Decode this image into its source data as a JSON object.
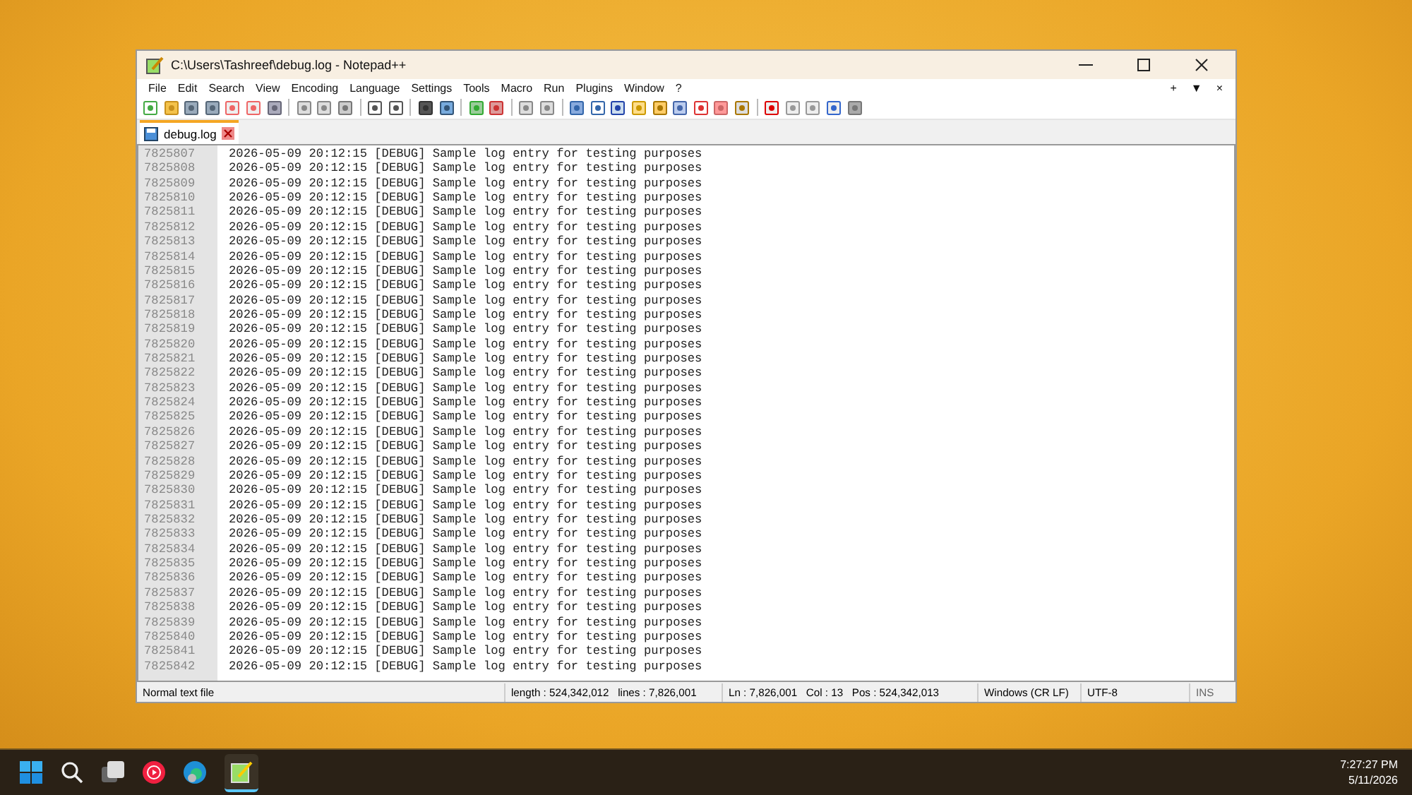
{
  "window": {
    "title": "C:\\Users\\Tashreef\\debug.log - Notepad++"
  },
  "menu": [
    "File",
    "Edit",
    "Search",
    "View",
    "Encoding",
    "Language",
    "Settings",
    "Tools",
    "Macro",
    "Run",
    "Plugins",
    "Window",
    "?"
  ],
  "menu_right": [
    "+",
    "▼",
    "×"
  ],
  "tabs": [
    {
      "label": "debug.log",
      "selected": true
    }
  ],
  "lines": [
    {
      "num": "7825807",
      "text": "2026-05-09 20:12:15 [DEBUG] Sample log entry for testing purposes"
    },
    {
      "num": "7825808",
      "text": "2026-05-09 20:12:15 [DEBUG] Sample log entry for testing purposes"
    },
    {
      "num": "7825809",
      "text": "2026-05-09 20:12:15 [DEBUG] Sample log entry for testing purposes"
    },
    {
      "num": "7825810",
      "text": "2026-05-09 20:12:15 [DEBUG] Sample log entry for testing purposes"
    },
    {
      "num": "7825811",
      "text": "2026-05-09 20:12:15 [DEBUG] Sample log entry for testing purposes"
    },
    {
      "num": "7825812",
      "text": "2026-05-09 20:12:15 [DEBUG] Sample log entry for testing purposes"
    },
    {
      "num": "7825813",
      "text": "2026-05-09 20:12:15 [DEBUG] Sample log entry for testing purposes"
    },
    {
      "num": "7825814",
      "text": "2026-05-09 20:12:15 [DEBUG] Sample log entry for testing purposes"
    },
    {
      "num": "7825815",
      "text": "2026-05-09 20:12:15 [DEBUG] Sample log entry for testing purposes"
    },
    {
      "num": "7825816",
      "text": "2026-05-09 20:12:15 [DEBUG] Sample log entry for testing purposes"
    },
    {
      "num": "7825817",
      "text": "2026-05-09 20:12:15 [DEBUG] Sample log entry for testing purposes"
    },
    {
      "num": "7825818",
      "text": "2026-05-09 20:12:15 [DEBUG] Sample log entry for testing purposes"
    },
    {
      "num": "7825819",
      "text": "2026-05-09 20:12:15 [DEBUG] Sample log entry for testing purposes"
    },
    {
      "num": "7825820",
      "text": "2026-05-09 20:12:15 [DEBUG] Sample log entry for testing purposes"
    },
    {
      "num": "7825821",
      "text": "2026-05-09 20:12:15 [DEBUG] Sample log entry for testing purposes"
    },
    {
      "num": "7825822",
      "text": "2026-05-09 20:12:15 [DEBUG] Sample log entry for testing purposes"
    },
    {
      "num": "7825823",
      "text": "2026-05-09 20:12:15 [DEBUG] Sample log entry for testing purposes"
    },
    {
      "num": "7825824",
      "text": "2026-05-09 20:12:15 [DEBUG] Sample log entry for testing purposes"
    },
    {
      "num": "7825825",
      "text": "2026-05-09 20:12:15 [DEBUG] Sample log entry for testing purposes"
    },
    {
      "num": "7825826",
      "text": "2026-05-09 20:12:15 [DEBUG] Sample log entry for testing purposes"
    },
    {
      "num": "7825827",
      "text": "2026-05-09 20:12:15 [DEBUG] Sample log entry for testing purposes"
    },
    {
      "num": "7825828",
      "text": "2026-05-09 20:12:15 [DEBUG] Sample log entry for testing purposes"
    },
    {
      "num": "7825829",
      "text": "2026-05-09 20:12:15 [DEBUG] Sample log entry for testing purposes"
    },
    {
      "num": "7825830",
      "text": "2026-05-09 20:12:15 [DEBUG] Sample log entry for testing purposes"
    },
    {
      "num": "7825831",
      "text": "2026-05-09 20:12:15 [DEBUG] Sample log entry for testing purposes"
    },
    {
      "num": "7825832",
      "text": "2026-05-09 20:12:15 [DEBUG] Sample log entry for testing purposes"
    },
    {
      "num": "7825833",
      "text": "2026-05-09 20:12:15 [DEBUG] Sample log entry for testing purposes"
    },
    {
      "num": "7825834",
      "text": "2026-05-09 20:12:15 [DEBUG] Sample log entry for testing purposes"
    },
    {
      "num": "7825835",
      "text": "2026-05-09 20:12:15 [DEBUG] Sample log entry for testing purposes"
    },
    {
      "num": "7825836",
      "text": "2026-05-09 20:12:15 [DEBUG] Sample log entry for testing purposes"
    },
    {
      "num": "7825837",
      "text": "2026-05-09 20:12:15 [DEBUG] Sample log entry for testing purposes"
    },
    {
      "num": "7825838",
      "text": "2026-05-09 20:12:15 [DEBUG] Sample log entry for testing purposes"
    },
    {
      "num": "7825839",
      "text": "2026-05-09 20:12:15 [DEBUG] Sample log entry for testing purposes"
    },
    {
      "num": "7825840",
      "text": "2026-05-09 20:12:15 [DEBUG] Sample log entry for testing purposes"
    },
    {
      "num": "7825841",
      "text": "2026-05-09 20:12:15 [DEBUG] Sample log entry for testing purposes"
    },
    {
      "num": "7825842",
      "text": "2026-05-09 20:12:15 [DEBUG] Sample log entry for testing purposes"
    }
  ],
  "status_bar": {
    "file_type": "Normal text file",
    "length": "length : 524,342,012",
    "lines": "lines : 7,826,001",
    "ln": "Ln : 7,826,001",
    "col": "Col : 13",
    "pos": "Pos : 524,342,013",
    "eol": "Windows (CR LF)",
    "encoding": "UTF-8",
    "mode": "INS"
  },
  "taskbar": {
    "time": "7:27:27 PM",
    "date": "5/11/2026"
  }
}
